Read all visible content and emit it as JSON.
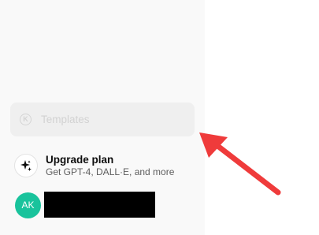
{
  "sidebar": {
    "templates": {
      "label": "Templates",
      "icon": "templates-icon"
    },
    "upgrade": {
      "title": "Upgrade plan",
      "subtitle": "Get GPT-4, DALL·E, and more",
      "icon": "sparkle-icon"
    },
    "account": {
      "avatar_initials": "AK",
      "avatar_color": "#19c39c",
      "name_redacted": true
    }
  },
  "annotation": {
    "arrow_color": "#ef3b3b"
  }
}
